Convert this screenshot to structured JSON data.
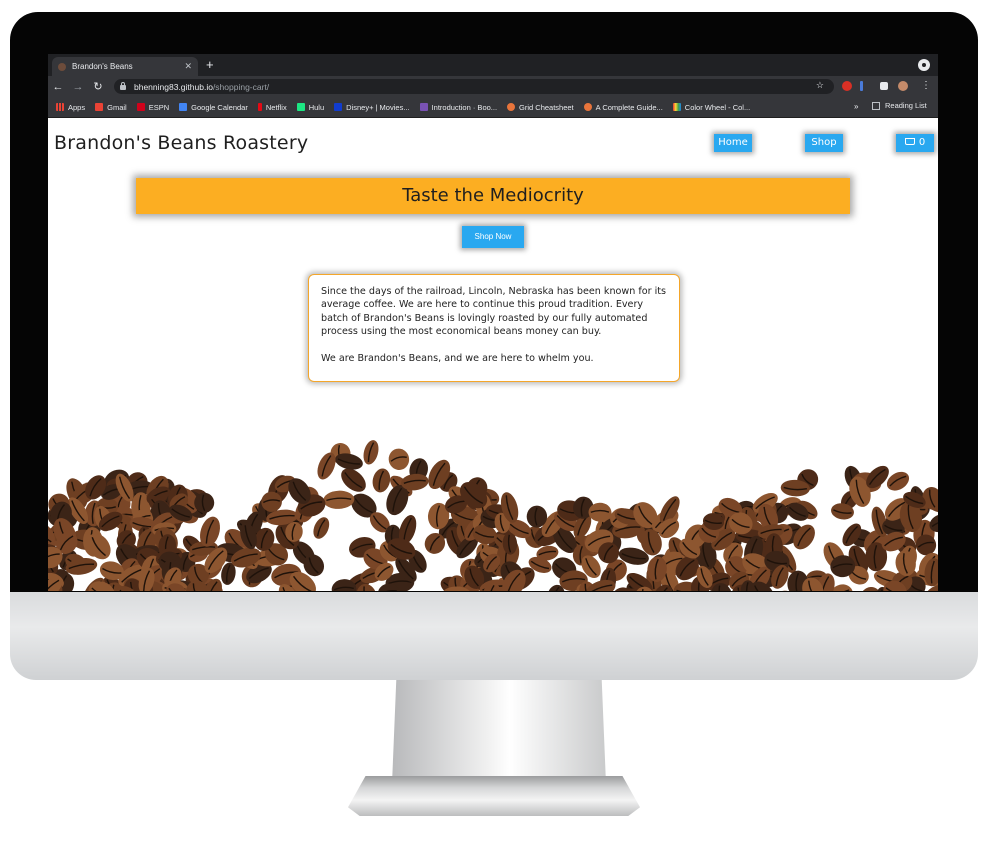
{
  "browser": {
    "tab_title": "Brandon's Beans",
    "tab_close": "✕",
    "new_tab": "+",
    "url_host": "bhenning83.github.io",
    "url_path": "/shopping-cart/",
    "bookmarks": [
      "Apps",
      "Gmail",
      "ESPN",
      "Google Calendar",
      "Netflix",
      "Hulu",
      "Disney+ | Movies...",
      "Introduction · Boo...",
      "Grid Cheatsheet",
      "A Complete Guide...",
      "Color Wheel - Col..."
    ],
    "bookmarks_more": "»",
    "reading_list": "Reading List"
  },
  "site": {
    "brand": "Brandon's Beans Roastery",
    "nav": {
      "home": "Home",
      "shop": "Shop",
      "cart_count": "0"
    },
    "hero_title": "Taste the Mediocrity",
    "cta": "Shop Now",
    "about": [
      "Since the days of the railroad, Lincoln, Nebraska has been known for its average coffee. We are here to continue this proud tradition. Every batch of Brandon's Beans is lovingly roasted by our fully automated process using the most economical beans money can buy.",
      "We are Brandon's Beans, and we are here to whelm you."
    ]
  },
  "colors": {
    "accent_blue": "#29a8f0",
    "hero_orange": "#fcae22",
    "card_border": "#f4a62a",
    "bean_dark": "#3b2417",
    "bean_mid": "#6e3f22",
    "bean_light": "#8d5630"
  },
  "icons": [
    "back-icon",
    "forward-icon",
    "reload-icon",
    "lock-icon",
    "star-icon",
    "extension-icon",
    "menu-icon",
    "cart-icon",
    "apps-grid-icon"
  ]
}
